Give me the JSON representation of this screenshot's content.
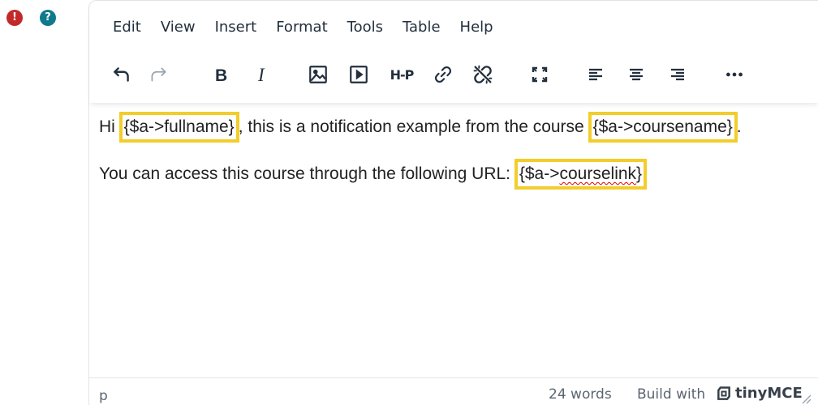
{
  "status_icons": [
    {
      "name": "error-icon",
      "glyph": "!",
      "color": "#c22a2a"
    },
    {
      "name": "help-icon",
      "glyph": "?",
      "color": "#0f7a8c"
    }
  ],
  "menubar": {
    "items": [
      "Edit",
      "View",
      "Insert",
      "Format",
      "Tools",
      "Table",
      "Help"
    ]
  },
  "toolbar": {
    "buttons": [
      "undo-icon",
      "redo-icon",
      "bold-icon",
      "italic-icon",
      "image-icon",
      "media-icon",
      "h5p-icon",
      "link-icon",
      "unlink-icon",
      "fullscreen-icon",
      "align-left-icon",
      "align-center-icon",
      "align-right-icon",
      "more-icon"
    ],
    "h5p_label": "H-P"
  },
  "content": {
    "line1": {
      "prefix": "Hi ",
      "placeholder1": "{$a->fullname}",
      "middle": ", this is a notification example from the course ",
      "placeholder2": "{$a->coursename}",
      "suffix": "."
    },
    "line2": {
      "prefix": "You can access this course through the following URL: ",
      "placeholder_open": "{$a->",
      "placeholder_misspelled": "courselink",
      "placeholder_close": "}"
    }
  },
  "statusbar": {
    "path": "p",
    "word_count": "24 words",
    "build_with": "Build with",
    "brand": "tinyMCE"
  },
  "colors": {
    "highlight": "#f2cd2c",
    "text": "#222f3e",
    "spellcheck": "#e00000"
  }
}
